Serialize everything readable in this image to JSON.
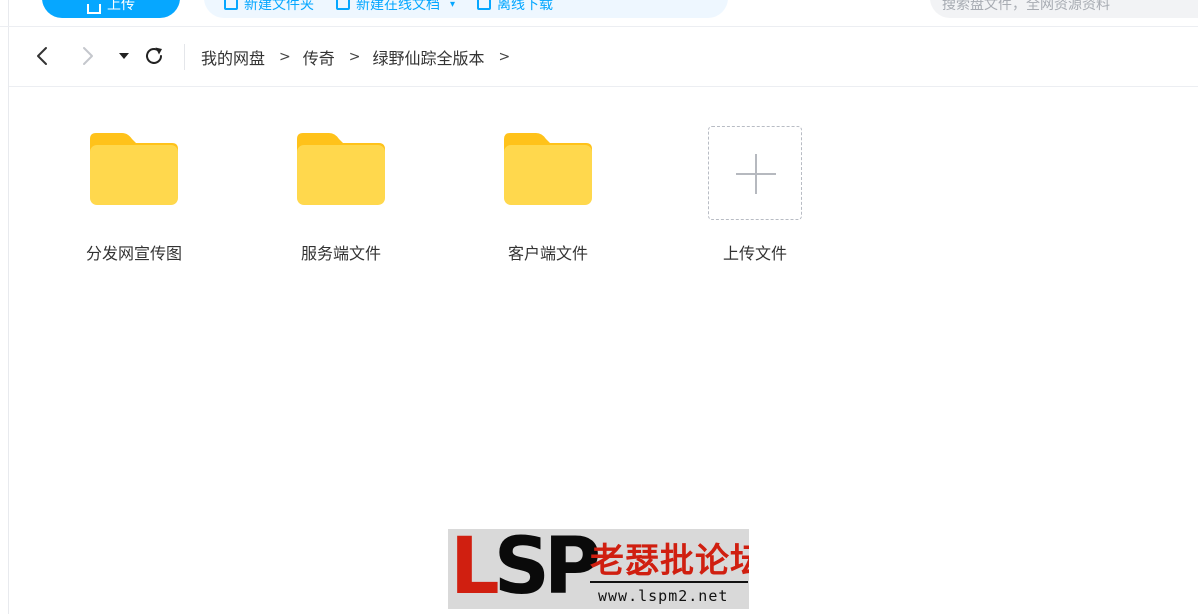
{
  "toolbar": {
    "upload_label": "上传",
    "tools": [
      {
        "label": "新建文件夹",
        "icon": "new-folder-icon"
      },
      {
        "label": "新建在线文档",
        "icon": "new-doc-icon"
      },
      {
        "label": "离线下载",
        "icon": "offline-download-icon"
      }
    ],
    "search_placeholder": "搜索盘文件，全网资源资料",
    "accent_color": "#06a7ff"
  },
  "nav": {
    "icons": [
      "back-icon",
      "forward-icon",
      "history-dropdown-icon",
      "refresh-icon"
    ],
    "breadcrumb": [
      "我的网盘",
      "传奇",
      "绿野仙踪全版本"
    ],
    "separator": ">"
  },
  "items": [
    {
      "label": "分发网宣传图",
      "type": "folder"
    },
    {
      "label": "服务端文件",
      "type": "folder"
    },
    {
      "label": "客户端文件",
      "type": "folder"
    },
    {
      "label": "上传文件",
      "type": "upload"
    }
  ],
  "colors": {
    "folder_front": "#ffd84d",
    "folder_back": "#ffc21a"
  },
  "watermark": {
    "letter_l": "L",
    "letters_sp": "SP",
    "chinese": "老瑟批论坛",
    "url": "www.lspm2.net"
  }
}
